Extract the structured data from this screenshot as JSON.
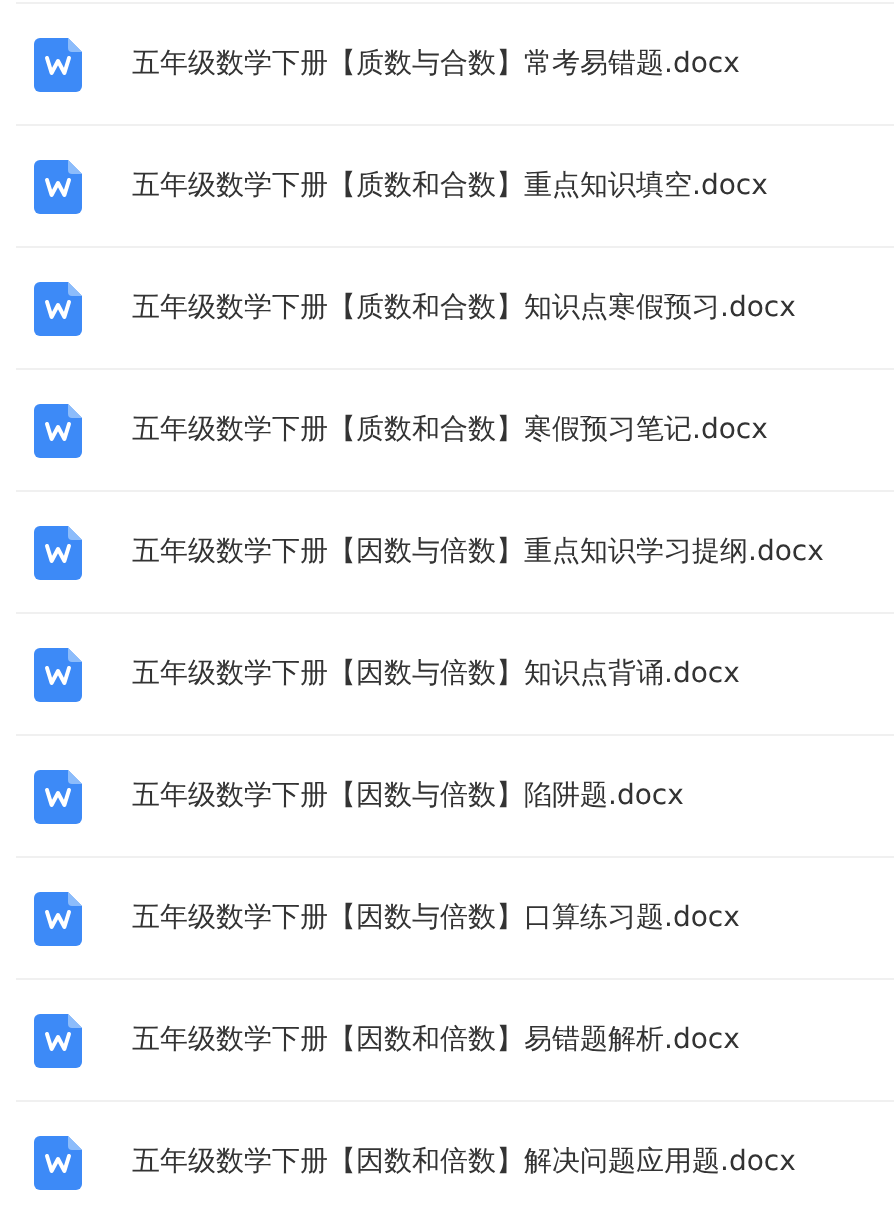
{
  "files": [
    {
      "name": "五年级数学下册【质数与合数】常考易错题.docx"
    },
    {
      "name": "五年级数学下册【质数和合数】重点知识填空.docx"
    },
    {
      "name": "五年级数学下册【质数和合数】知识点寒假预习.docx"
    },
    {
      "name": "五年级数学下册【质数和合数】寒假预习笔记.docx"
    },
    {
      "name": "五年级数学下册【因数与倍数】重点知识学习提纲.docx"
    },
    {
      "name": "五年级数学下册【因数与倍数】知识点背诵.docx"
    },
    {
      "name": "五年级数学下册【因数与倍数】陷阱题.docx"
    },
    {
      "name": "五年级数学下册【因数与倍数】口算练习题.docx"
    },
    {
      "name": "五年级数学下册【因数和倍数】易错题解析.docx"
    },
    {
      "name": "五年级数学下册【因数和倍数】解决问题应用题.docx"
    }
  ]
}
